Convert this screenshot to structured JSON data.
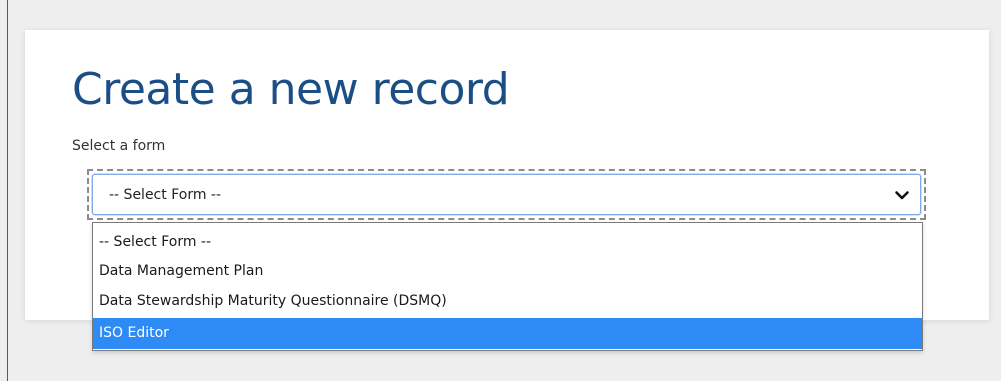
{
  "page": {
    "title": "Create a new record"
  },
  "form_select": {
    "label": "Select a form",
    "selected_value": "-- Select Form --",
    "options": [
      {
        "label": "-- Select Form --",
        "highlighted": false
      },
      {
        "label": "Data Management Plan",
        "highlighted": false
      },
      {
        "label": "Data Stewardship Maturity Questionnaire (DSMQ)",
        "highlighted": false
      },
      {
        "label": "ISO Editor",
        "highlighted": true
      }
    ],
    "icon": "chevron-down-icon"
  },
  "colors": {
    "title": "#1c4e86",
    "highlight": "#2e8af5",
    "background": "#eeeeee",
    "card": "#ffffff"
  }
}
